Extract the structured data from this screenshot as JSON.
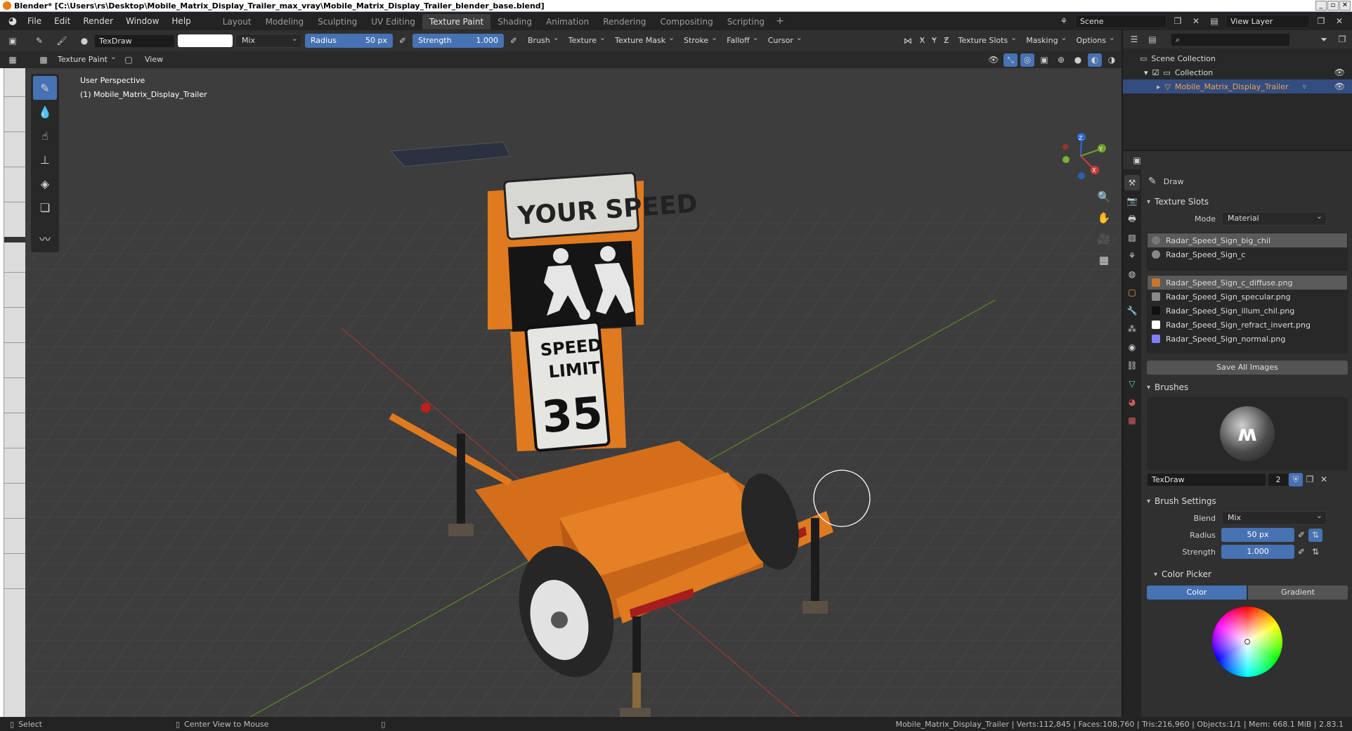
{
  "window": {
    "title": "Blender* [C:\\Users\\rs\\Desktop\\Mobile_Matrix_Display_Trailer_max_vray\\Mobile_Matrix_Display_Trailer_blender_base.blend]",
    "buttons": [
      "_",
      "▫",
      "✕"
    ]
  },
  "menu": [
    "File",
    "Edit",
    "Render",
    "Window",
    "Help"
  ],
  "workspaces": [
    "Layout",
    "Modeling",
    "Sculpting",
    "UV Editing",
    "Texture Paint",
    "Shading",
    "Animation",
    "Rendering",
    "Compositing",
    "Scripting"
  ],
  "active_workspace": "Texture Paint",
  "scene": {
    "name": "Scene",
    "view_layer": "View Layer"
  },
  "toolsettings": {
    "brush_name": "TexDraw",
    "blend": "Mix",
    "radius_label": "Radius",
    "radius_value": "50 px",
    "strength_label": "Strength",
    "strength_value": "1.000",
    "menus": [
      "Brush",
      "Texture",
      "Texture Mask",
      "Stroke",
      "Falloff",
      "Cursor"
    ],
    "axes": [
      "X",
      "Y",
      "Z"
    ],
    "right_menus": [
      "Texture Slots",
      "Masking",
      "Options"
    ]
  },
  "header": {
    "mode": "Texture Paint",
    "view": "View"
  },
  "viewport": {
    "perspective": "User Perspective",
    "object_label": "(1) Mobile_Matrix_Display_Trailer",
    "sign_top": "YOUR SPEED",
    "sign_limit_1": "SPEED",
    "sign_limit_2": "LIMIT",
    "sign_limit_num": "35",
    "gizmo": {
      "x": "X",
      "y": "Y",
      "z": "Z"
    }
  },
  "outliner": {
    "scene_collection": "Scene Collection",
    "collection": "Collection",
    "object": "Mobile_Matrix_Display_Trailer"
  },
  "properties": {
    "tool_name": "Draw",
    "texture_slots_title": "Texture Slots",
    "mode_label": "Mode",
    "mode_value": "Material",
    "materials": [
      "Radar_Speed_Sign_big_chil",
      "Radar_Speed_Sign_c"
    ],
    "images": [
      {
        "name": "Radar_Speed_Sign_c_diffuse.png",
        "color": "#c8742a"
      },
      {
        "name": "Radar_Speed_Sign_specular.png",
        "color": "#8a8a8a"
      },
      {
        "name": "Radar_Speed_Sign_illum_chil.png",
        "color": "#111111"
      },
      {
        "name": "Radar_Speed_Sign_refract_invert.png",
        "color": "#ffffff"
      },
      {
        "name": "Radar_Speed_Sign_normal.png",
        "color": "#8080ff"
      }
    ],
    "save_all": "Save All Images",
    "brushes_title": "Brushes",
    "brush_field": "TexDraw",
    "brush_users": "2",
    "brush_settings_title": "Brush Settings",
    "blend_label": "Blend",
    "blend_value": "Mix",
    "radius_label": "Radius",
    "radius_value": "50 px",
    "strength_label": "Strength",
    "strength_value": "1.000",
    "color_picker_title": "Color Picker",
    "color_tab": "Color",
    "gradient_tab": "Gradient"
  },
  "status": {
    "select": "Select",
    "center": "Center View to Mouse",
    "stats": "Mobile_Matrix_Display_Trailer | Verts:112,845 | Faces:108,760 | Tris:216,960 | Objects:1/1 | Mem: 668.1 MiB | 2.83.1"
  },
  "colors": {
    "accent": "#4772b3",
    "orange": "#e07a1f",
    "selection": "#334d80"
  }
}
